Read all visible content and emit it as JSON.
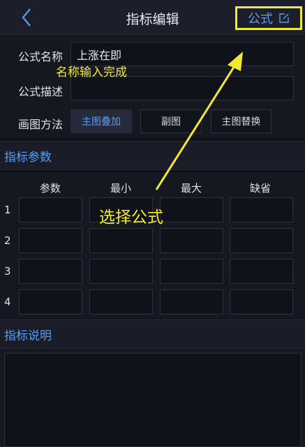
{
  "nav": {
    "title": "指标编辑",
    "formula_label": "公式"
  },
  "form": {
    "name_label": "公式名称",
    "name_value": "上涨在即",
    "desc_label": "公式描述",
    "desc_value": "",
    "draw_label": "画图方法",
    "draw_options": [
      "主图叠加",
      "副图",
      "主图替换"
    ],
    "draw_selected": "主图叠加"
  },
  "params": {
    "section_title": "指标参数",
    "columns": [
      "参数",
      "最小",
      "最大",
      "缺省"
    ],
    "rows": [
      "1",
      "2",
      "3",
      "4"
    ]
  },
  "description": {
    "section_title": "指标说明",
    "value": ""
  },
  "annotations": {
    "name_done": "名称输入完成",
    "choose_formula": "选择公式",
    "color": "#f2ea30"
  },
  "colors": {
    "accent": "#5a9cf0",
    "highlight": "#f0ea3a",
    "background": "#0f1119"
  }
}
